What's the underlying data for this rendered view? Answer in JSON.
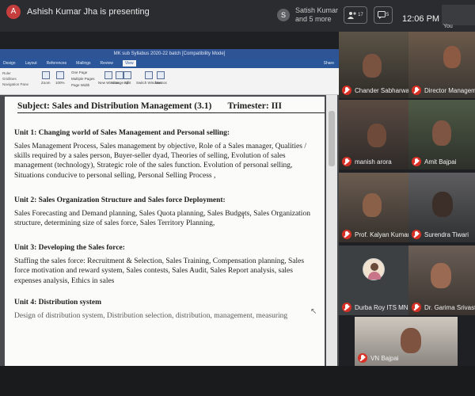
{
  "top_bar": {
    "presenter_initial": "A",
    "presenter_text": "Ashish Kumar Jha is presenting",
    "others_initial": "S",
    "others_line1": "Satish Kumar",
    "others_line2": "and 5 more",
    "participants_count": "17",
    "chat_count": "5",
    "time": "12:06 PM",
    "you_label": "You"
  },
  "word": {
    "title": "MK sub Syllabus 2020-22 batch [Compatibility Mode]",
    "tabs": [
      "Design",
      "Layout",
      "References",
      "Mailings",
      "Review",
      "View"
    ],
    "active_tab": "View",
    "side_items": [
      "Ruler",
      "Gridlines",
      "Navigation Pane"
    ],
    "ribbon_items": [
      "Zoom",
      "100%",
      "One Page",
      "Multiple Pages",
      "Page Width",
      "New Window",
      "Arrange All",
      "Split",
      "Switch Windows",
      "Macros"
    ],
    "share_label": "Share"
  },
  "document": {
    "subject": "Subject:  Sales and Distribution Management (3.1)",
    "trimester": "Trimester: III",
    "units": [
      {
        "heading": "Unit 1: Changing world of Sales Management and Personal selling:",
        "body": "Sales Management Process, Sales management by objective, Role of a Sales manager, Qualities / skills required by a sales person, Buyer-seller dyad, Theories of selling, Evolution of sales management (technology), Strategic role of the sales function. Evolution of personal selling, Situations conducive to personal selling, Personal Selling Process ,"
      },
      {
        "heading": "Unit 2: Sales Organization Structure and Sales force Deployment:",
        "body": "Sales Forecasting and Demand planning, Sales Quota planning, Sales Budgets, Sales Organization structure, determining size of sales force, Sales Territory Planning,"
      },
      {
        "heading": "Unit 3: Developing the Sales force:",
        "body": "Staffing the sales force: Recruitment & Selection, Sales Training, Compensation planning, Sales force motivation and reward system, Sales contests, Sales Audit,   Sales Report analysis, sales expenses analysis, Ethics in sales"
      },
      {
        "heading": "Unit 4: Distribution system",
        "body": "Design of distribution system, Distribution selection, distribution, management, measuring"
      }
    ]
  },
  "participants": [
    {
      "name": "Chander Sabharwal"
    },
    {
      "name": "Director Managemen..."
    },
    {
      "name": "manish arora"
    },
    {
      "name": "Amit Bajpai"
    },
    {
      "name": "Prof. Kalyan Kumar De"
    },
    {
      "name": "Surendra Tiwari"
    },
    {
      "name": "Durba Roy ITS MN"
    },
    {
      "name": "Dr. Garima Srivastav"
    },
    {
      "name": "VN Bajpai"
    }
  ],
  "colors": {
    "mic_muted": "#d93025",
    "word_blue": "#2b579a",
    "background": "#1f2023"
  }
}
